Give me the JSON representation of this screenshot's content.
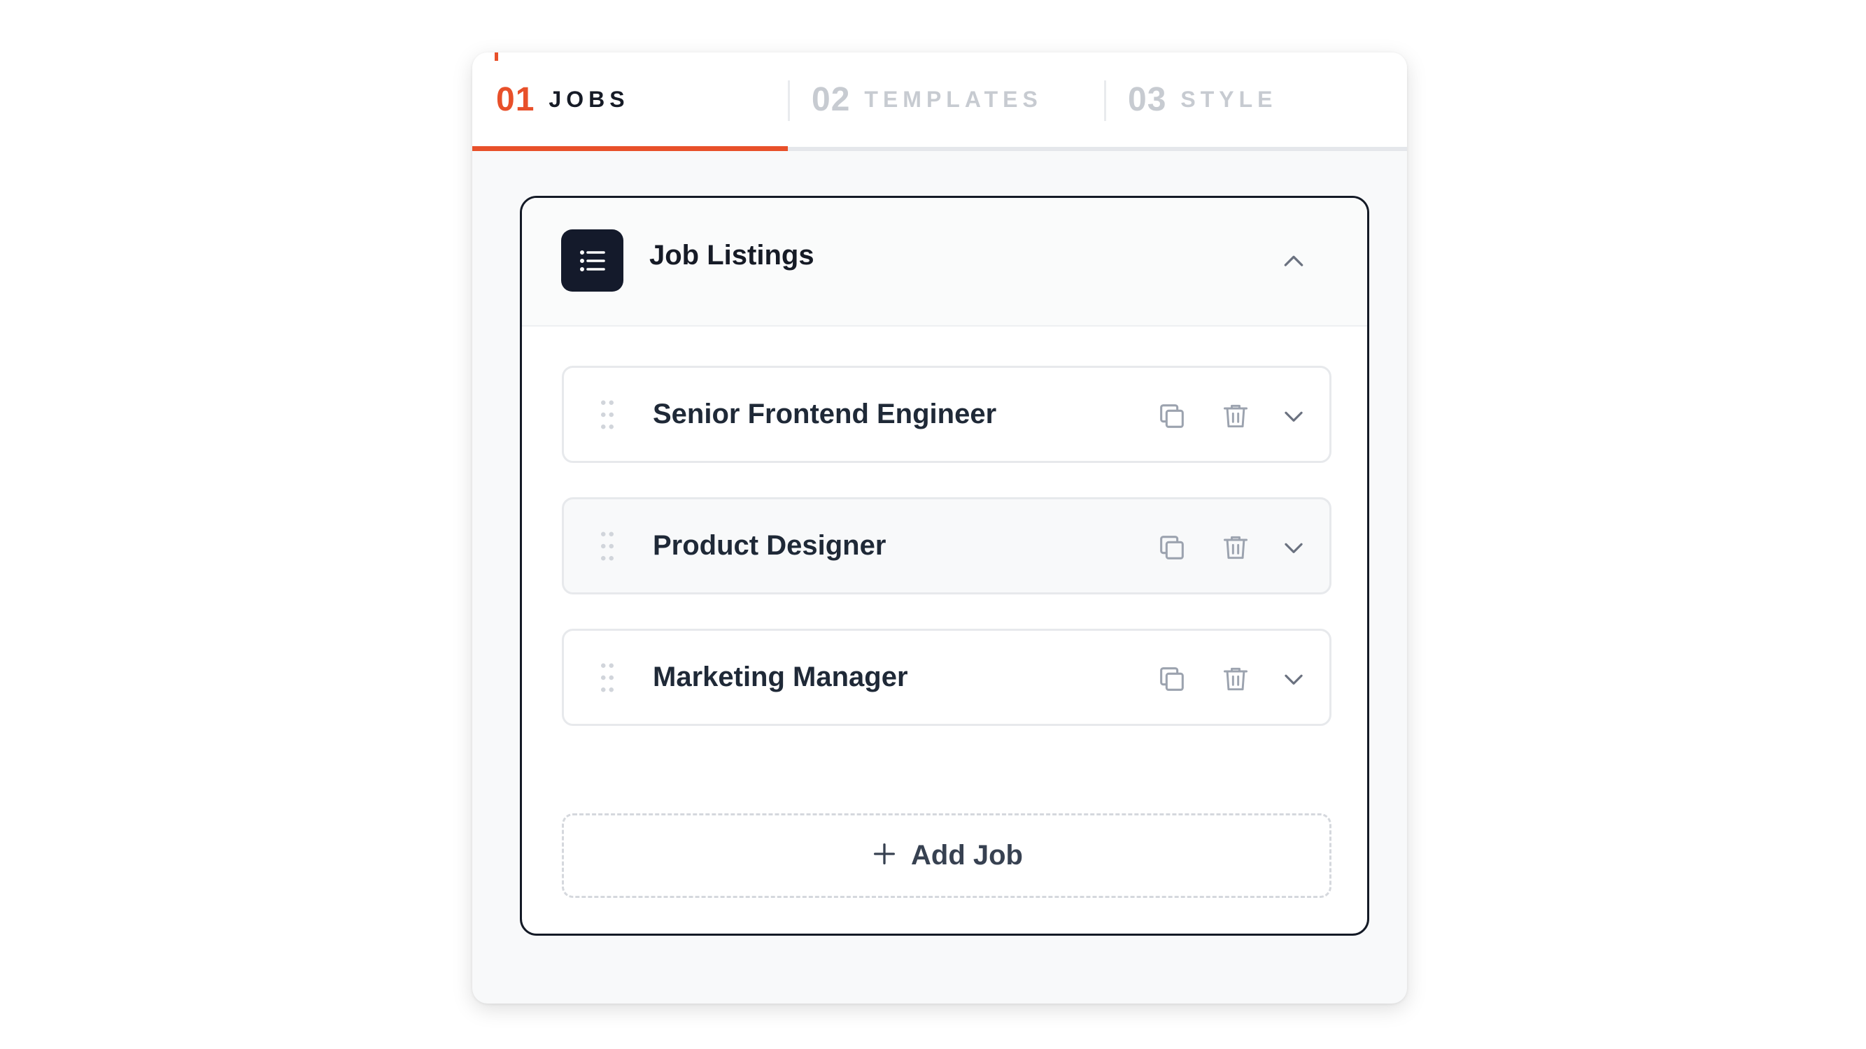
{
  "tabs": [
    {
      "number": "01",
      "label": "JOBS",
      "active": true
    },
    {
      "number": "02",
      "label": "TEMPLATES",
      "active": false
    },
    {
      "number": "03",
      "label": "STYLE",
      "active": false
    }
  ],
  "section": {
    "title": "Job Listings",
    "icon": "list-icon",
    "collapse_icon": "chevron-up-icon"
  },
  "jobs": [
    {
      "title": "Senior Frontend Engineer"
    },
    {
      "title": "Product Designer"
    },
    {
      "title": "Marketing Manager"
    }
  ],
  "job_actions": [
    "copy-icon",
    "trash-icon",
    "chevron-down-icon"
  ],
  "add_button": {
    "label": "Add Job",
    "icon": "plus-icon"
  },
  "colors": {
    "accent": "#e8502a",
    "dark": "#141a2b",
    "text": "#1f2937",
    "muted": "#c7cbd1",
    "icon": "#9ca3af"
  }
}
